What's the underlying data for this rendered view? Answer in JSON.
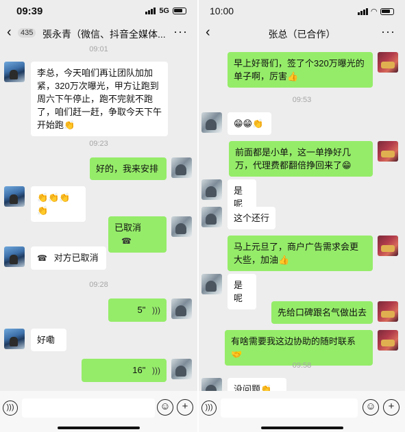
{
  "left": {
    "status": {
      "time": "09:39",
      "network": "5G"
    },
    "nav": {
      "unread_count": "435",
      "title": "張永青（微信、抖音全媒体..."
    },
    "messages": {
      "t1": "09:01",
      "m1": "李总，今天咱们再让团队加加紧，320万次曝光，甲方让跑到周六下午停止，跑不完就不跑了，咱们赶一赶，争取今天下午开始跑👏",
      "t2": "09:23",
      "m2": "好的，我来安排",
      "m3": "👏👏👏👏",
      "m4": "已取消",
      "m5": "对方已取消",
      "t3": "09:28",
      "m6": "5\"",
      "m7": "好嘞",
      "m8": "16\""
    }
  },
  "right": {
    "status": {
      "time": "10:00"
    },
    "nav": {
      "title": "张总（已合作）"
    },
    "messages": {
      "m1": "早上好哥们，签了个320万曝光的单子啊，厉害👍",
      "t1": "09:53",
      "m2": "😁😁👏",
      "m3": "前面都是小单，这一单挣好几万，代理费都翻倍挣回来了😁",
      "m4": "是呢",
      "m5": "这个还行",
      "m6": "马上元旦了，商户广告需求会更大些，加油👍",
      "m7": "是呢",
      "m8": "先给口碑跟名气做出去",
      "m9": "有啥需要我这边协助的随时联系🤝",
      "t2": "09:58",
      "m10": "没问题👏👏"
    }
  },
  "icons": {
    "back": "chevron-left-icon",
    "more": "more-icon",
    "voice_input": "voice-input-icon",
    "emoji": "emoji-icon",
    "plus": "plus-icon",
    "voice_message": "voice-wave-icon",
    "call": "phone-icon"
  },
  "colors": {
    "outgoing_bubble": "#95ec69",
    "incoming_bubble": "#ffffff",
    "chat_background": "#ededed"
  }
}
